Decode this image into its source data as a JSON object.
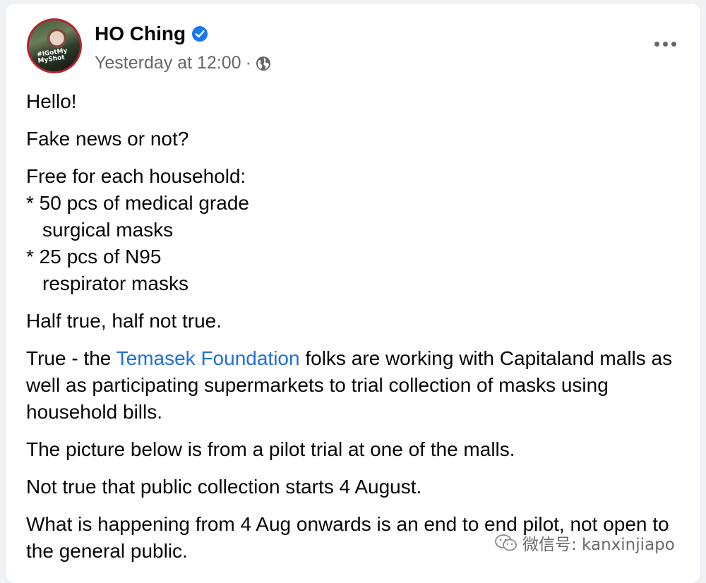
{
  "post": {
    "author": "HO Ching",
    "timestamp": "Yesterday at 12:00",
    "separator": "·",
    "avatar_badge_line1": "#iGotMy",
    "avatar_badge_line2": "MyShot",
    "body": {
      "p1": "Hello!",
      "p2": "Fake news or not?",
      "p3_line1": "Free for each household:",
      "p3_line2": "* 50 pcs of medical grade",
      "p3_line3": "surgical masks",
      "p3_line4": "* 25 pcs of N95",
      "p3_line5": "respirator masks",
      "p4": "Half true, half not true.",
      "p5_before": "True - the ",
      "p5_link": "Temasek Foundation",
      "p5_after": " folks are working with Capitaland malls as well as participating supermarkets to trial collection of masks using household bills.",
      "p6": "The picture below is from a pilot trial at one of the malls.",
      "p7": "Not true that public collection starts 4 August.",
      "p8": "What is happening from 4 Aug onwards is an end to end pilot, not open to the general public."
    }
  },
  "watermark": {
    "text": "微信号: kanxinjiapo"
  },
  "icons": {
    "verified": "verified-badge-icon",
    "privacy": "globe-icon",
    "more": "more-options-icon",
    "watermark": "wechat-icon"
  },
  "colors": {
    "link": "#216fdb",
    "verified": "#1877f2",
    "meta": "#65676b",
    "text": "#050505"
  }
}
